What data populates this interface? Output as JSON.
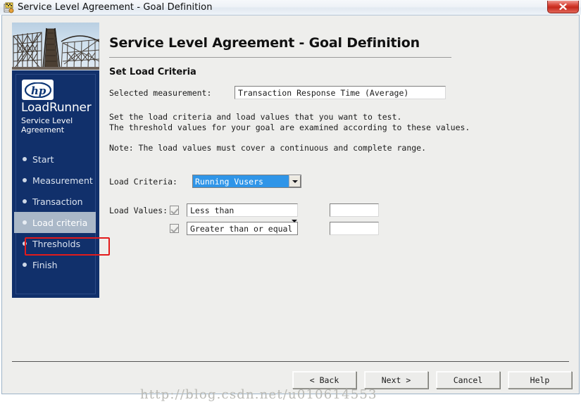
{
  "window": {
    "title": "Service Level Agreement - Goal Definition",
    "icon": "sla-wizard-icon",
    "close_label": "✕"
  },
  "sidebar": {
    "logo": "hp-logo",
    "brand": "LoadRunner",
    "brand_sub": "Service Level\nAgreement",
    "items": [
      {
        "label": "Start",
        "active": false
      },
      {
        "label": "Measurement",
        "active": false
      },
      {
        "label": "Transaction",
        "active": false
      },
      {
        "label": "Load criteria",
        "active": true
      },
      {
        "label": "Thresholds",
        "active": false
      },
      {
        "label": "Finish",
        "active": false
      }
    ],
    "annotation_target": "Load criteria",
    "annotation_color": "#e31b1b",
    "background_color": "#11306b",
    "active_background_color": "#aab8c8"
  },
  "main": {
    "title": "Service Level Agreement - Goal Definition",
    "subtitle": "Set Load Criteria",
    "measurement": {
      "label": "Selected measurement:",
      "value": "Transaction Response Time (Average)"
    },
    "description_line1": "Set the load criteria and load values that you want to test.",
    "description_line2": "The threshold values for your goal are examined according to these values.",
    "note": "Note: The load values must cover a continuous and complete range.",
    "load_criteria": {
      "label": "Load Criteria:",
      "value": "Running Vusers",
      "selected": true,
      "highlight_color": "#2f95e8"
    },
    "load_values": {
      "label": "Load Values:",
      "rows": [
        {
          "checked": true,
          "operator": "Less than",
          "has_dropdown": false,
          "value": ""
        },
        {
          "checked": true,
          "operator": "Greater than or equal t",
          "has_dropdown": true,
          "value": ""
        }
      ]
    }
  },
  "footer": {
    "buttons": [
      {
        "label": "< Back"
      },
      {
        "label": "Next >"
      },
      {
        "label": "Cancel"
      },
      {
        "label": "Help"
      }
    ]
  },
  "watermark": "http://blog.csdn.net/u010614553"
}
